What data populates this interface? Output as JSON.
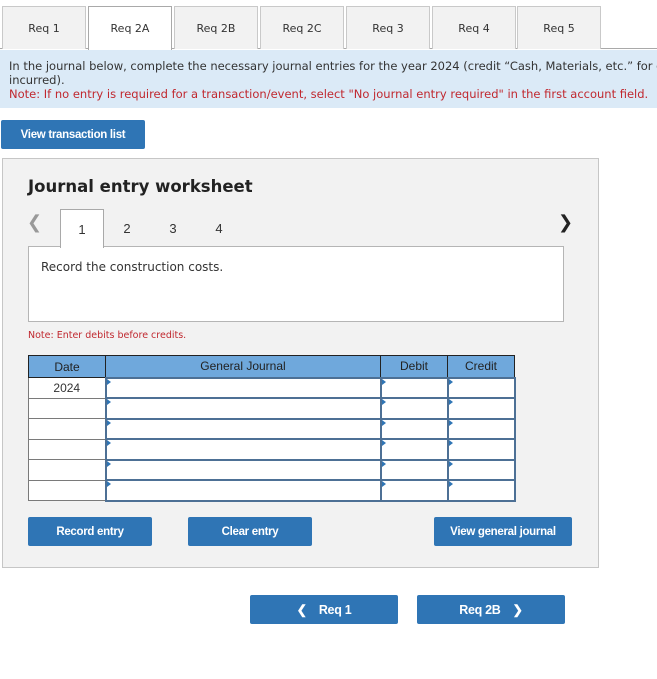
{
  "tabs": [
    {
      "label": "Req 1",
      "active": false
    },
    {
      "label": "Req 2A",
      "active": true
    },
    {
      "label": "Req 2B",
      "active": false
    },
    {
      "label": "Req 2C",
      "active": false
    },
    {
      "label": "Req 3",
      "active": false
    },
    {
      "label": "Req 4",
      "active": false
    },
    {
      "label": "Req 5",
      "active": false
    }
  ],
  "banner": {
    "main_line1": "In the journal below, complete the necessary journal entries for the year 2024 (credit “Cash, Materials, etc.” for costs",
    "main_line2": "incurred).",
    "note": "Note: If no entry is required for a transaction/event, select \"No journal entry required\" in the first account field."
  },
  "view_transaction_list_label": "View transaction list",
  "worksheet": {
    "title": "Journal entry worksheet",
    "prev_icon": "chevron-left-icon",
    "next_icon": "chevron-right-icon",
    "pages": [
      "1",
      "2",
      "3",
      "4"
    ],
    "active_page": "1",
    "description": "Record the construction costs.",
    "note": "Note: Enter debits before credits.",
    "table": {
      "headers": {
        "date": "Date",
        "general_journal": "General Journal",
        "debit": "Debit",
        "credit": "Credit"
      },
      "rows": [
        {
          "date": "2024",
          "account": "",
          "debit": "",
          "credit": ""
        },
        {
          "date": "",
          "account": "",
          "debit": "",
          "credit": ""
        },
        {
          "date": "",
          "account": "",
          "debit": "",
          "credit": ""
        },
        {
          "date": "",
          "account": "",
          "debit": "",
          "credit": ""
        },
        {
          "date": "",
          "account": "",
          "debit": "",
          "credit": ""
        },
        {
          "date": "",
          "account": "",
          "debit": "",
          "credit": ""
        }
      ]
    },
    "buttons": {
      "record": "Record entry",
      "clear": "Clear entry",
      "view_general_journal": "View general journal"
    }
  },
  "nav": {
    "prev_label": "Req 1",
    "next_label": "Req 2B"
  },
  "colors": {
    "button_blue": "#2f75b5",
    "banner_bg": "#dbeaf7",
    "note_red": "#c0282f",
    "table_header": "#6fa8dc",
    "panel_bg": "#f2f2f2"
  }
}
